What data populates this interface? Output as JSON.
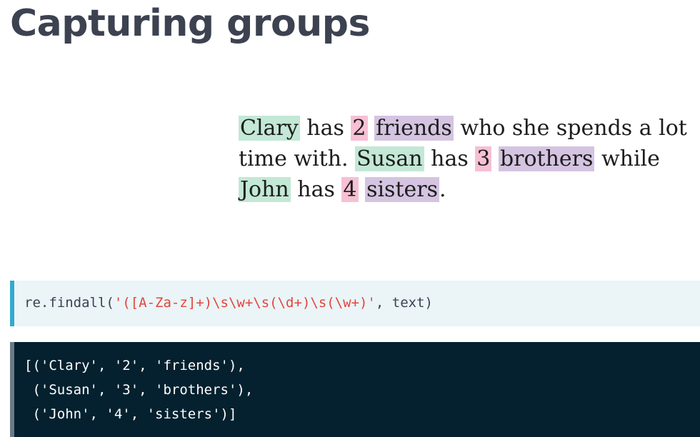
{
  "slide": {
    "title": "Capturing groups"
  },
  "sentence": {
    "line1": {
      "name": "Clary",
      "t1": " has ",
      "num": "2",
      "t2": " ",
      "word": "friends",
      "t3": " who she spends a lot"
    },
    "line2": {
      "t0": "time with. ",
      "name": "Susan",
      "t1": " has ",
      "num": "3",
      "t2": " ",
      "word": "brothers",
      "t3": " while"
    },
    "line3": {
      "name": "John",
      "t1": " has ",
      "num": "4",
      "t2": " ",
      "word": "sisters",
      "t3": "."
    }
  },
  "code_input": {
    "prefix": "re.findall(",
    "pattern": "'([A-Za-z]+)\\s\\w+\\s(\\d+)\\s(\\w+)'",
    "suffix": ", text)"
  },
  "code_output": {
    "lines": [
      "[('Clary', '2', 'friends'),",
      " ('Susan', '3', 'brothers'),",
      " ('John', '4', 'sisters')]"
    ]
  },
  "colors": {
    "name_highlight": "#c3e8d6",
    "number_highlight": "#f7c0d4",
    "word_highlight": "#d4c4e1",
    "input_accent": "#33aacc",
    "output_background": "#05212f",
    "string_color": "#e0463c"
  }
}
